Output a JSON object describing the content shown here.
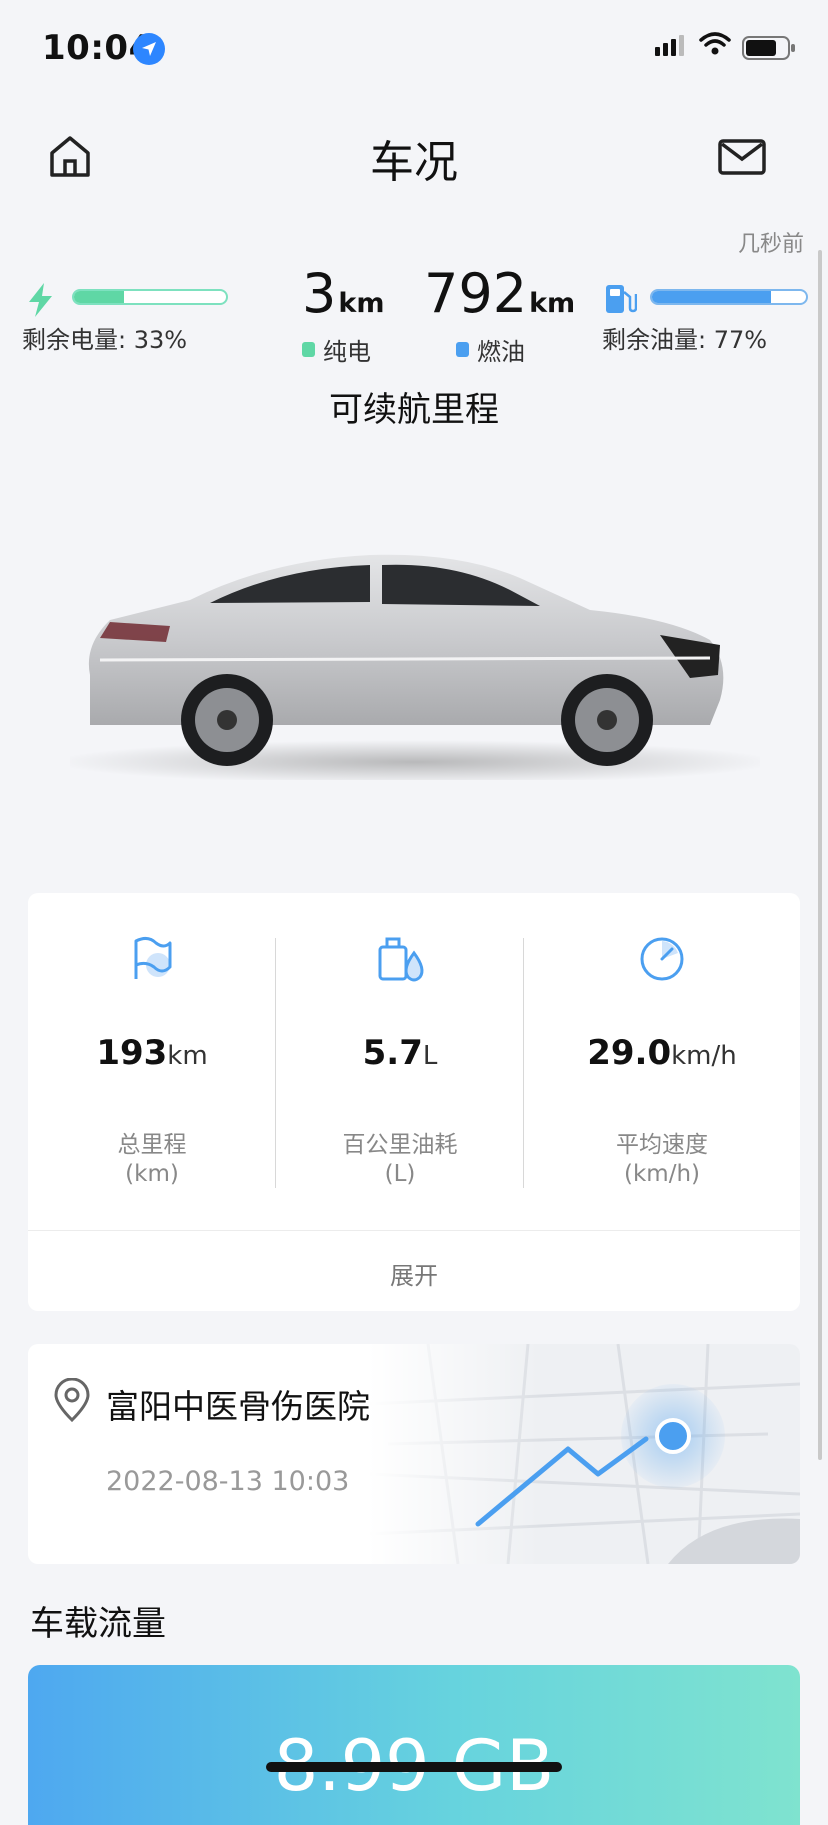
{
  "status_bar": {
    "time": "10:04",
    "location_icon": "location-arrow-icon"
  },
  "header": {
    "title": "车况",
    "home_icon": "home-icon",
    "mail_icon": "mail-icon",
    "updated": "几秒前"
  },
  "energy": {
    "electric": {
      "label": "剩余电量: 33%",
      "level": 0.33,
      "color": "#5fd7a5"
    },
    "fuel": {
      "label": "剩余油量: 77%",
      "level": 0.77,
      "color": "#4b9ff0"
    }
  },
  "range": {
    "electric_value": "3",
    "electric_unit": "km",
    "electric_tag": "纯电",
    "fuel_value": "792",
    "fuel_unit": "km",
    "fuel_tag": "燃油",
    "label": "可续航里程"
  },
  "stats": [
    {
      "icon": "flag-icon",
      "value": "193",
      "unit": "km",
      "label": "总里程",
      "sub": "(km)"
    },
    {
      "icon": "oil-drop-icon",
      "value": "5.7",
      "unit": "L",
      "label": "百公里油耗",
      "sub": "(L)"
    },
    {
      "icon": "speedometer-icon",
      "value": "29.0",
      "unit": "km/h",
      "label": "平均速度",
      "sub": "(km/h)"
    }
  ],
  "expand_label": "展开",
  "location": {
    "icon": "location-pin-icon",
    "place": "富阳中医骨伤医院",
    "time": "2022-08-13 10:03"
  },
  "data_usage": {
    "title": "车载流量",
    "value": "8.99 GB"
  },
  "colors": {
    "accent": "#4b9ff0",
    "electric": "#5fd7a5"
  }
}
